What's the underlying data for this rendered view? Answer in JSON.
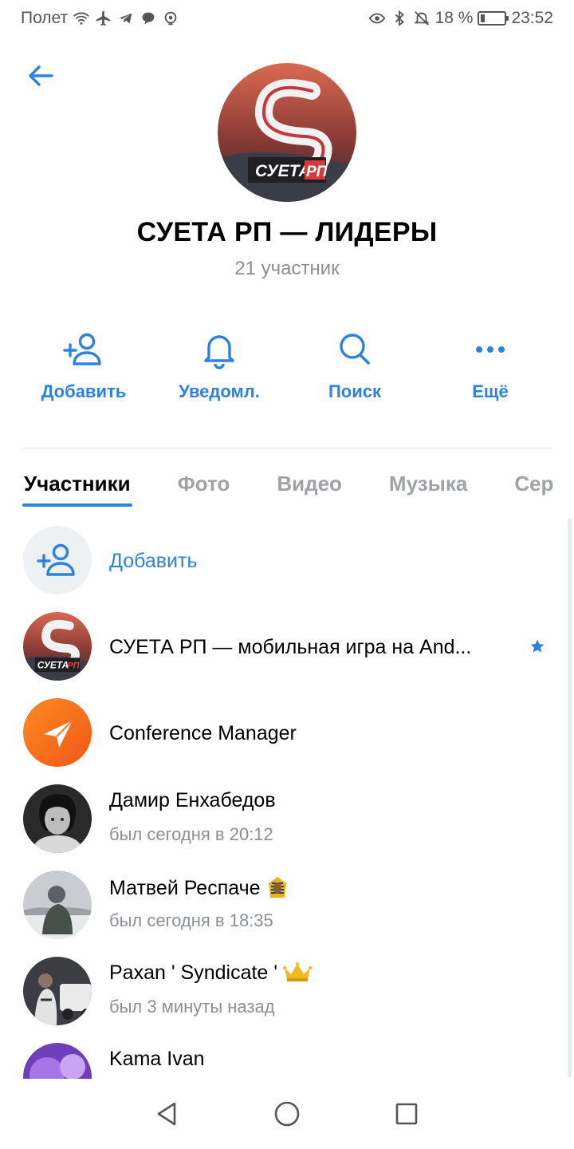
{
  "status_bar": {
    "carrier": "Полет",
    "battery": "18 %",
    "time": "23:52",
    "battery_level": 0.18
  },
  "header": {
    "title": "СУЕТА РП — ЛИДЕРЫ",
    "members": "21 участник",
    "avatar_text": "СУЕТА",
    "avatar_text2": "РП"
  },
  "actions": [
    {
      "label": "Добавить",
      "icon": "add-user-icon"
    },
    {
      "label": "Уведомл.",
      "icon": "bell-icon"
    },
    {
      "label": "Поиск",
      "icon": "search-icon"
    },
    {
      "label": "Ещё",
      "icon": "more-icon"
    }
  ],
  "tabs": [
    {
      "label": "Участники",
      "active": true
    },
    {
      "label": "Фото"
    },
    {
      "label": "Видео"
    },
    {
      "label": "Музыка"
    },
    {
      "label": "Сер"
    }
  ],
  "members": {
    "add_label": "Добавить",
    "items": [
      {
        "name": "СУЕТА РП — мобильная игра на And...",
        "status": "",
        "verified": true,
        "avatar_text": "СУЕТА",
        "avatar_text2": "РП"
      },
      {
        "name": "Conference Manager",
        "status": ""
      },
      {
        "name": "Дамир Енхабедов",
        "status": "был сегодня в 20:12"
      },
      {
        "name": "Матвей Респаче",
        "status": "был сегодня в 18:35",
        "emoji": "pharaoh-emoji"
      },
      {
        "name": "Paxan ' Syndicate '",
        "status": "был 3 минуты назад",
        "emoji": "crown-emoji"
      },
      {
        "name": "Kama Ivan",
        "status": ""
      }
    ]
  },
  "colors": {
    "accent": "#2d81e0",
    "secondary_text": "#8b8f95"
  }
}
